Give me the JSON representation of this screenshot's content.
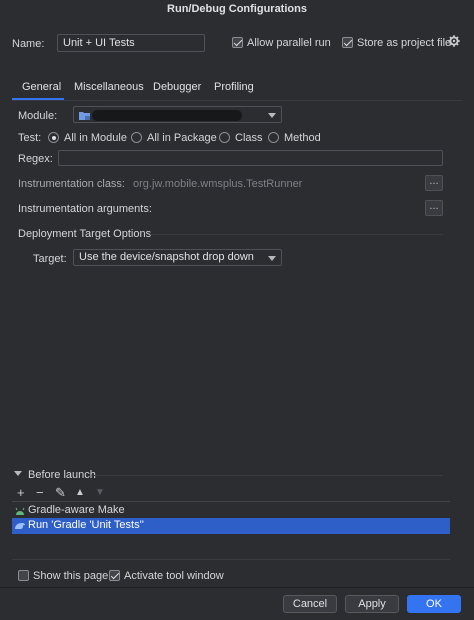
{
  "window": {
    "title": "Run/Debug Configurations"
  },
  "header": {
    "name_label": "Name:",
    "name_value": "Unit + UI Tests",
    "allow_parallel_label": "Allow parallel run",
    "allow_parallel_checked": true,
    "store_as_file_label": "Store as project file",
    "store_as_file_checked": true
  },
  "tabs": [
    {
      "label": "General",
      "active": true
    },
    {
      "label": "Miscellaneous",
      "active": false
    },
    {
      "label": "Debugger",
      "active": false
    },
    {
      "label": "Profiling",
      "active": false
    }
  ],
  "general": {
    "module_label": "Module:",
    "test_label": "Test:",
    "test_options": [
      {
        "label": "All in Module",
        "selected": true
      },
      {
        "label": "All in Package",
        "selected": false
      },
      {
        "label": "Class",
        "selected": false
      },
      {
        "label": "Method",
        "selected": false
      }
    ],
    "regex_label": "Regex:",
    "regex_value": "",
    "instrumentation_class_label": "Instrumentation class:",
    "instrumentation_class_value": "org.jw.mobile.wmsplus.TestRunner",
    "instrumentation_args_label": "Instrumentation arguments:",
    "deployment_section_label": "Deployment Target Options",
    "target_label": "Target:",
    "target_value": "Use the device/snapshot drop down",
    "ellipsis": "..."
  },
  "before_launch": {
    "label": "Before launch",
    "toolbar": {
      "add": "+",
      "remove": "−",
      "edit": "✎",
      "up": "▲",
      "down": "▼"
    },
    "items": [
      {
        "label": "Gradle-aware Make",
        "selected": false
      },
      {
        "label": "Run 'Gradle 'Unit Tests''",
        "selected": true
      }
    ]
  },
  "footer": {
    "show_page_label": "Show this page",
    "show_page_checked": false,
    "activate_tool_label": "Activate tool window",
    "activate_tool_checked": true,
    "cancel_label": "Cancel",
    "apply_label": "Apply",
    "ok_label": "OK"
  },
  "colors": {
    "accent": "#3574f0",
    "background": "#2b2d30",
    "selection": "#2e5ec7"
  }
}
